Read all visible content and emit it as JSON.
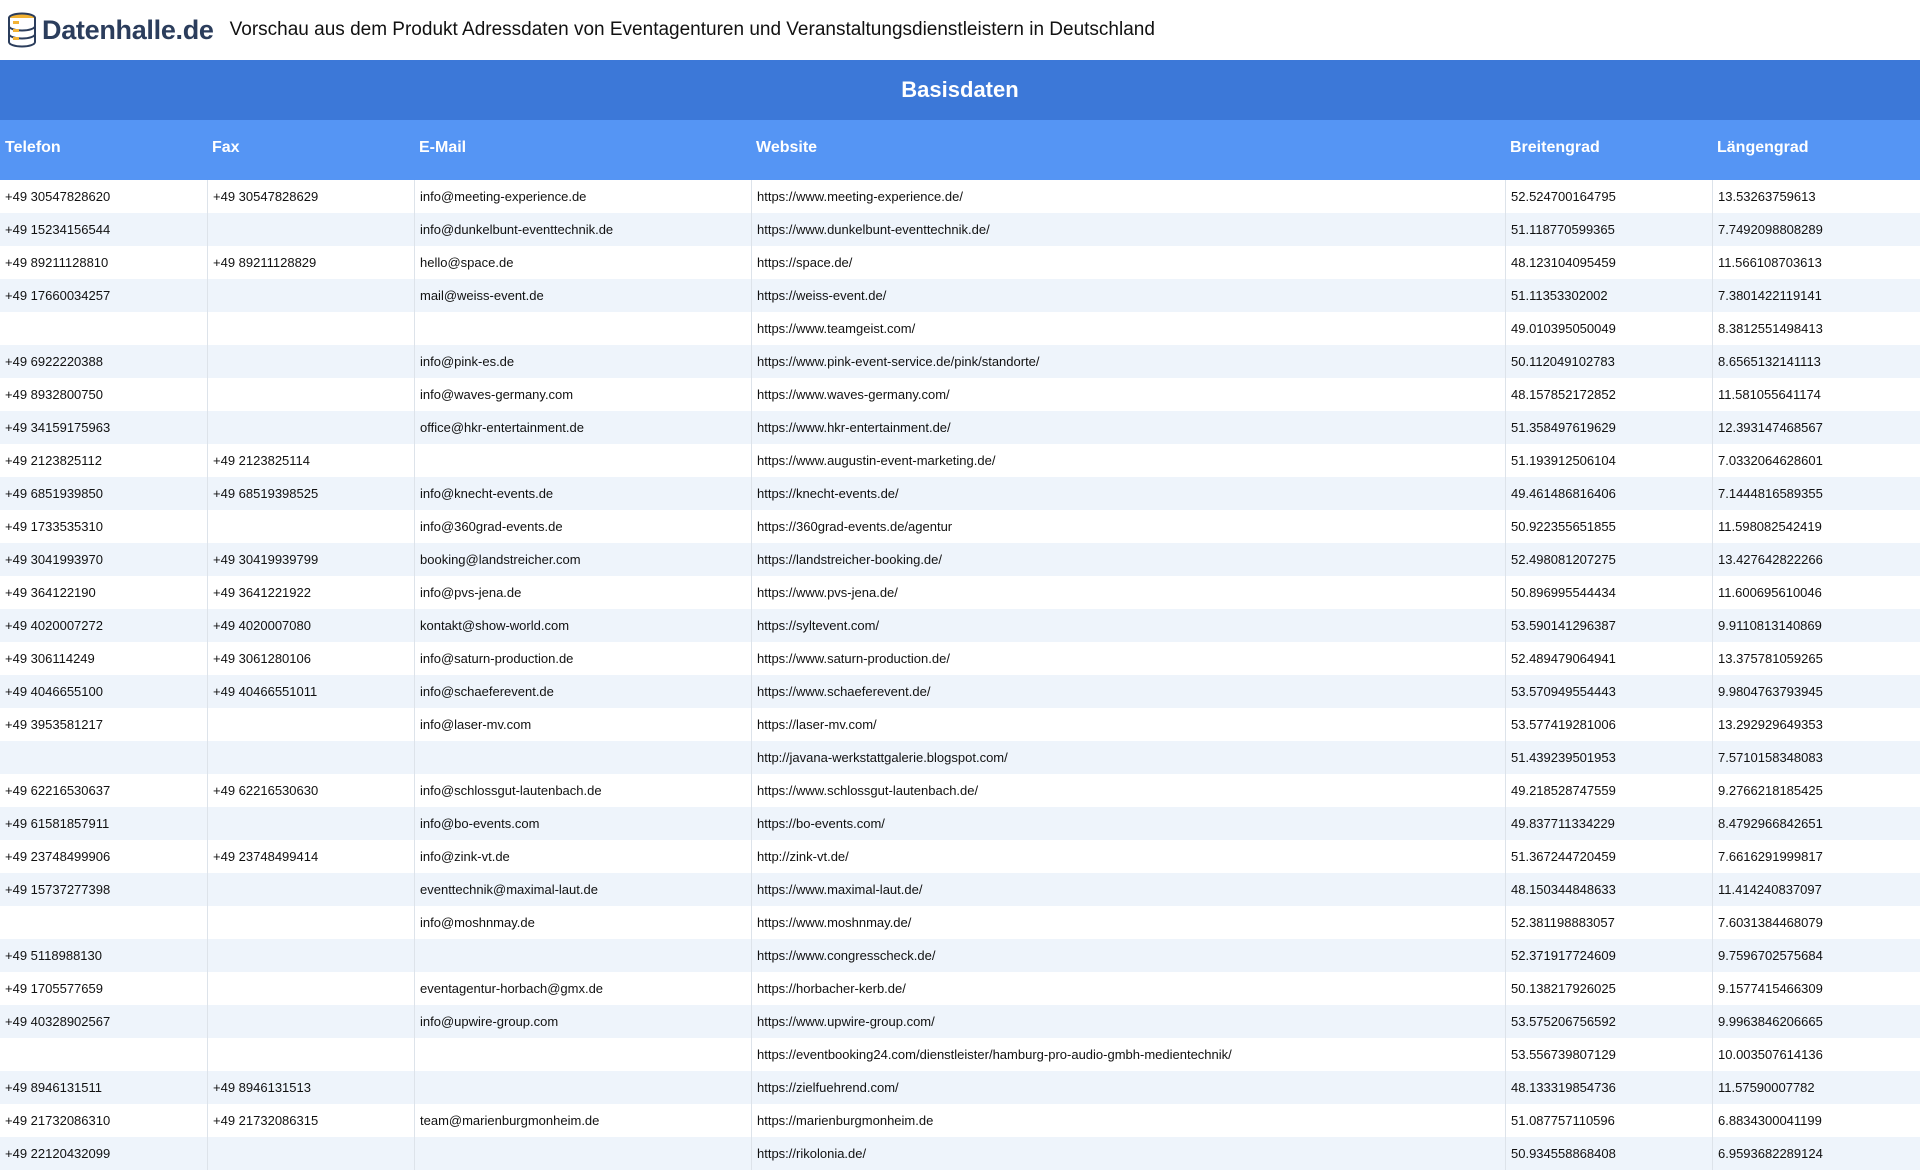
{
  "header": {
    "logo_text": "Datenhalle.de",
    "title": "Vorschau aus dem Produkt Adressdaten von Eventagenturen und Veranstaltungsdienstleistern in Deutschland"
  },
  "table": {
    "group_title": "Basisdaten",
    "columns": [
      "Telefon",
      "Fax",
      "E-Mail",
      "Website",
      "Breitengrad",
      "Längengrad"
    ],
    "rows": [
      [
        "+49 30547828620",
        "+49 30547828629",
        "info@meeting-experience.de",
        "https://www.meeting-experience.de/",
        "52.524700164795",
        "13.53263759613"
      ],
      [
        "+49 15234156544",
        "",
        "info@dunkelbunt-eventtechnik.de",
        "https://www.dunkelbunt-eventtechnik.de/",
        "51.118770599365",
        "7.7492098808289"
      ],
      [
        "+49 89211128810",
        "+49 89211128829",
        "hello@space.de",
        "https://space.de/",
        "48.123104095459",
        "11.566108703613"
      ],
      [
        "+49 17660034257",
        "",
        "mail@weiss-event.de",
        "https://weiss-event.de/",
        "51.11353302002",
        "7.3801422119141"
      ],
      [
        "",
        "",
        "",
        "https://www.teamgeist.com/",
        "49.010395050049",
        "8.3812551498413"
      ],
      [
        "+49 6922220388",
        "",
        "info@pink-es.de",
        "https://www.pink-event-service.de/pink/standorte/",
        "50.112049102783",
        "8.6565132141113"
      ],
      [
        "+49 8932800750",
        "",
        "info@waves-germany.com",
        "https://www.waves-germany.com/",
        "48.157852172852",
        "11.581055641174"
      ],
      [
        "+49 34159175963",
        "",
        "office@hkr-entertainment.de",
        "https://www.hkr-entertainment.de/",
        "51.358497619629",
        "12.393147468567"
      ],
      [
        "+49 2123825112",
        "+49 2123825114",
        "",
        "https://www.augustin-event-marketing.de/",
        "51.193912506104",
        "7.0332064628601"
      ],
      [
        "+49 6851939850",
        "+49 68519398525",
        "info@knecht-events.de",
        "https://knecht-events.de/",
        "49.461486816406",
        "7.1444816589355"
      ],
      [
        "+49 1733535310",
        "",
        "info@360grad-events.de",
        "https://360grad-events.de/agentur",
        "50.922355651855",
        "11.598082542419"
      ],
      [
        "+49 3041993970",
        "+49 30419939799",
        "booking@landstreicher.com",
        "https://landstreicher-booking.de/",
        "52.498081207275",
        "13.427642822266"
      ],
      [
        "+49 364122190",
        "+49 3641221922",
        "info@pvs-jena.de",
        "https://www.pvs-jena.de/",
        "50.896995544434",
        "11.600695610046"
      ],
      [
        "+49 4020007272",
        "+49 4020007080",
        "kontakt@show-world.com",
        "https://syltevent.com/",
        "53.590141296387",
        "9.9110813140869"
      ],
      [
        "+49 306114249",
        "+49 3061280106",
        "info@saturn-production.de",
        "https://www.saturn-production.de/",
        "52.489479064941",
        "13.375781059265"
      ],
      [
        "+49 4046655100",
        "+49 40466551011",
        "info@schaeferevent.de",
        "https://www.schaeferevent.de/",
        "53.570949554443",
        "9.9804763793945"
      ],
      [
        "+49 3953581217",
        "",
        "info@laser-mv.com",
        "https://laser-mv.com/",
        "53.577419281006",
        "13.292929649353"
      ],
      [
        "",
        "",
        "",
        "http://javana-werkstattgalerie.blogspot.com/",
        "51.439239501953",
        "7.5710158348083"
      ],
      [
        "+49 62216530637",
        "+49 62216530630",
        "info@schlossgut-lautenbach.de",
        "https://www.schlossgut-lautenbach.de/",
        "49.218528747559",
        "9.2766218185425"
      ],
      [
        "+49 61581857911",
        "",
        "info@bo-events.com",
        "https://bo-events.com/",
        "49.837711334229",
        "8.4792966842651"
      ],
      [
        "+49 23748499906",
        "+49 23748499414",
        "info@zink-vt.de",
        "http://zink-vt.de/",
        "51.367244720459",
        "7.6616291999817"
      ],
      [
        "+49 15737277398",
        "",
        "eventtechnik@maximal-laut.de",
        "https://www.maximal-laut.de/",
        "48.150344848633",
        "11.414240837097"
      ],
      [
        "",
        "",
        "info@moshnmay.de",
        "https://www.moshnmay.de/",
        "52.381198883057",
        "7.6031384468079"
      ],
      [
        "+49 5118988130",
        "",
        "",
        "https://www.congresscheck.de/",
        "52.371917724609",
        "9.7596702575684"
      ],
      [
        "+49 1705577659",
        "",
        "eventagentur-horbach@gmx.de",
        "https://horbacher-kerb.de/",
        "50.138217926025",
        "9.1577415466309"
      ],
      [
        "+49 40328902567",
        "",
        "info@upwire-group.com",
        "https://www.upwire-group.com/",
        "53.575206756592",
        "9.9963846206665"
      ],
      [
        "",
        "",
        "",
        "https://eventbooking24.com/dienstleister/hamburg-pro-audio-gmbh-medientechnik/",
        "53.556739807129",
        "10.003507614136"
      ],
      [
        "+49 8946131511",
        "+49 8946131513",
        "",
        "https://zielfuehrend.com/",
        "48.133319854736",
        "11.57590007782"
      ],
      [
        "+49 21732086310",
        "+49 21732086315",
        "team@marienburgmonheim.de",
        "https://marienburgmonheim.de",
        "51.087757110596",
        "6.8834300041199"
      ],
      [
        "+49 22120432099",
        "",
        "",
        "https://rikolonia.de/",
        "50.934558868408",
        "6.9593682289124"
      ]
    ]
  },
  "colors": {
    "group_header_bg": "#3c78d8",
    "column_header_bg": "#5595f4",
    "row_alt_bg": "#eef4fb"
  },
  "icons": {
    "logo": "database-cylinder-icon"
  }
}
